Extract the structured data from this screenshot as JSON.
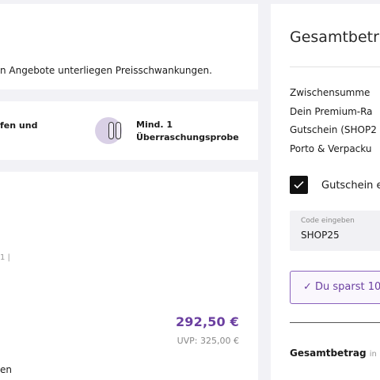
{
  "notice": {
    "text": "n Angebote unterliegen Preisschwankungen."
  },
  "benefits": {
    "left_text": "fen und",
    "right_line1": "Mind. 1",
    "right_line2": "Überraschungsprobe",
    "icon": "capsules-icon"
  },
  "product": {
    "meta": "1 |",
    "price": "292,50 €",
    "uvp": "UVP: 325,00 €",
    "bottom_text": "en"
  },
  "summary": {
    "title": "Gesamtbetr",
    "lines": [
      "Zwischensumme",
      "Dein Premium-Ra",
      "Gutschein (SHOP2",
      "Porto & Verpacku"
    ],
    "coupon_label": "Gutschein e",
    "code_placeholder": "Code eingeben",
    "code_value": "SHOP25",
    "savings": "✓ Du sparst 10",
    "total_label": "Gesamtbetrag",
    "total_suffix": "in"
  },
  "colors": {
    "accent": "#6b3fa0",
    "background": "#f2f2f6"
  }
}
